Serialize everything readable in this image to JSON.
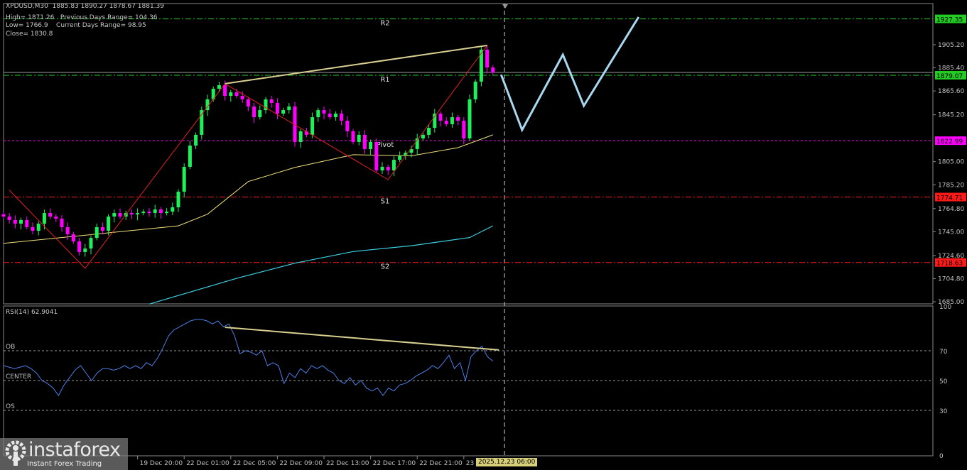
{
  "header": {
    "symbol_line": "XPDUSD,M30  1885.83 1890.27 1878.67 1881.39",
    "line2": "High= 1871.26   Previous Days Range= 104.36",
    "line3": "Low= 1766.9    Current Days Range= 98.95",
    "line4": "Close= 1830.8",
    "rsi_label": "RSI(14) 62.9041"
  },
  "logo": {
    "name": "instaforex",
    "tagline": "Instant Forex Trading"
  },
  "cursor_date": "2025.12.23 06:00",
  "colors": {
    "bull": "#1ef05a",
    "bear": "#ff00ff",
    "ma_fast": "#f0e07a",
    "ma_slow": "#3ccfe0",
    "zigzag": "#e02020",
    "trendline": "#d8cf90",
    "forecast": "#a8d8f0",
    "rsi": "#4d7fe8"
  },
  "chart_data": [
    {
      "type": "candlestick",
      "title": "XPDUSD,M30",
      "ylim": [
        1685.0,
        1935.0
      ],
      "y_ticks": [
        "1905.20",
        "1885.40",
        "1865.60",
        "1845.20",
        "1805.00",
        "1785.20",
        "1764.80",
        "1745.00",
        "1724.60",
        "1704.80",
        "1685.00"
      ],
      "x_ticks": [
        {
          "index": 23,
          "label": "19 Dec 20:00"
        },
        {
          "index": 31,
          "label": "22 Dec 01:00"
        },
        {
          "index": 39,
          "label": "22 Dec 05:00"
        },
        {
          "index": 47,
          "label": "22 Dec 09:00"
        },
        {
          "index": 55,
          "label": "22 Dec 13:00"
        },
        {
          "index": 63,
          "label": "22 Dec 17:00"
        },
        {
          "index": 71,
          "label": "22 Dec 21:00"
        },
        {
          "index": 79,
          "label": "23 Dec"
        }
      ],
      "closes": [
        1758.0,
        1755.0,
        1751.9,
        1755.0,
        1748.9,
        1745.8,
        1751.9,
        1761.0,
        1758.0,
        1756.2,
        1748.9,
        1742.8,
        1736.7,
        1727.6,
        1730.6,
        1739.7,
        1748.9,
        1745.8,
        1758.0,
        1761.0,
        1758.0,
        1761.0,
        1759.8,
        1761.0,
        1762.2,
        1761.0,
        1764.1,
        1761.0,
        1762.2,
        1765.9,
        1779.3,
        1800.6,
        1818.8,
        1828.0,
        1849.2,
        1858.4,
        1867.5,
        1870.5,
        1861.4,
        1864.4,
        1861.4,
        1858.4,
        1852.3,
        1843.1,
        1849.2,
        1858.4,
        1855.3,
        1846.2,
        1849.2,
        1852.3,
        1821.9,
        1831.0,
        1828.0,
        1843.1,
        1849.2,
        1846.2,
        1843.1,
        1846.2,
        1840.1,
        1831.0,
        1821.9,
        1828.0,
        1815.8,
        1821.9,
        1797.5,
        1800.6,
        1797.5,
        1806.6,
        1809.7,
        1812.7,
        1815.8,
        1824.9,
        1828.0,
        1834.0,
        1846.2,
        1840.1,
        1837.1,
        1843.1,
        1840.1,
        1824.9,
        1858.4,
        1873.6,
        1901.0,
        1885.7,
        1881.39
      ],
      "levels": [
        {
          "label": "R2",
          "value": "1927.35",
          "color": "#22cc22"
        },
        {
          "label": "R1",
          "value": "1879.07",
          "color": "#22cc22"
        },
        {
          "label": "Pivot",
          "value": "1822.99",
          "color": "#ff00ff"
        },
        {
          "label": "S1",
          "value": "1774.71",
          "color": "#ff1a1a"
        },
        {
          "label": "S2",
          "value": "1718.63",
          "color": "#ff1a1a"
        }
      ],
      "ma_fast": [
        [
          0,
          1735
        ],
        [
          30,
          1750
        ],
        [
          35,
          1760
        ],
        [
          42,
          1788
        ],
        [
          50,
          1800
        ],
        [
          60,
          1811
        ],
        [
          70,
          1810
        ],
        [
          78,
          1817
        ],
        [
          84,
          1828
        ]
      ],
      "ma_slow": [
        [
          25,
          1683
        ],
        [
          40,
          1705
        ],
        [
          50,
          1718
        ],
        [
          60,
          1728
        ],
        [
          70,
          1733
        ],
        [
          80,
          1740
        ],
        [
          84,
          1750
        ]
      ],
      "zigzag": [
        [
          1,
          1780.5
        ],
        [
          14,
          1713.6
        ],
        [
          38,
          1871.8
        ],
        [
          66,
          1789.6
        ],
        [
          83,
          1904.6
        ]
      ],
      "trendline": [
        [
          38,
          1871.8
        ],
        [
          83,
          1904.6
        ]
      ],
      "forecast": [
        [
          85.4,
          1879.6
        ],
        [
          89,
          1832.2
        ],
        [
          96,
          1896.7
        ],
        [
          99.6,
          1852.9
        ],
        [
          109,
          1928.9
        ]
      ]
    },
    {
      "type": "line",
      "title": "RSI(14) 62.9041",
      "ylim": [
        0,
        100
      ],
      "y_ticks": [
        "100",
        "70",
        "50",
        "30",
        "0"
      ],
      "levels": [
        {
          "label": "OB",
          "value": 70
        },
        {
          "label": "CENTER",
          "value": 50
        },
        {
          "label": "OS",
          "value": 30
        }
      ],
      "values": [
        60,
        59,
        58,
        59,
        60,
        58,
        55,
        50,
        48,
        45,
        40,
        47,
        52,
        57,
        60,
        55,
        50,
        55,
        58,
        58,
        57,
        58,
        60,
        58,
        60,
        58,
        62,
        60,
        65,
        72,
        80,
        84,
        86,
        88,
        90,
        91,
        91,
        90,
        88,
        90,
        86,
        88,
        80,
        68,
        70,
        69,
        67,
        70,
        60,
        62,
        60,
        48,
        55,
        52,
        58,
        55,
        60,
        58,
        60,
        57,
        55,
        50,
        48,
        52,
        47,
        50,
        45,
        43,
        45,
        40,
        45,
        43,
        47,
        48,
        50,
        53,
        55,
        57,
        60,
        58,
        62,
        67,
        58,
        62,
        50,
        66,
        70,
        73,
        66,
        63
      ],
      "trendline": [
        [
          38,
          85.7
        ],
        [
          85,
          70.5
        ]
      ]
    }
  ]
}
